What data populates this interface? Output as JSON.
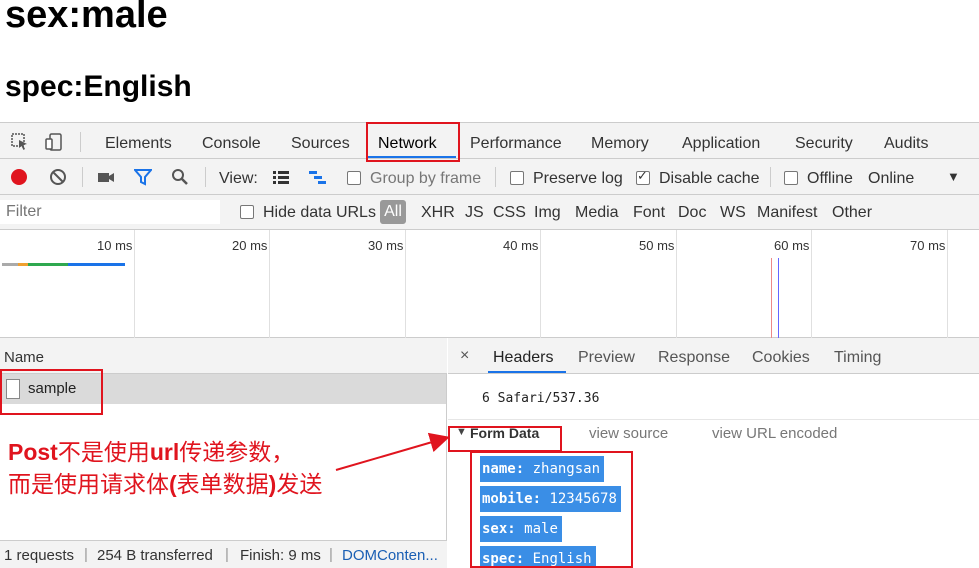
{
  "page": {
    "heading_sex": "sex:male",
    "heading_spec": "spec:English"
  },
  "devtools": {
    "main_tabs": [
      {
        "label": "Elements"
      },
      {
        "label": "Console"
      },
      {
        "label": "Sources"
      },
      {
        "label": "Network",
        "active": true
      },
      {
        "label": "Performance"
      },
      {
        "label": "Memory"
      },
      {
        "label": "Application"
      },
      {
        "label": "Security"
      },
      {
        "label": "Audits"
      }
    ],
    "toolbar": {
      "view_label": "View:",
      "group_by_frame": "Group by frame",
      "preserve_log": "Preserve log",
      "disable_cache": "Disable cache",
      "disable_cache_checked": true,
      "offline": "Offline",
      "throttle": "Online"
    },
    "filter": {
      "placeholder": "Filter",
      "hide_data_urls": "Hide data URLs",
      "types": [
        "All",
        "XHR",
        "JS",
        "CSS",
        "Img",
        "Media",
        "Font",
        "Doc",
        "WS",
        "Manifest",
        "Other"
      ]
    },
    "timeline": {
      "ticks": [
        "10 ms",
        "20 ms",
        "30 ms",
        "40 ms",
        "50 ms",
        "60 ms",
        "70 ms"
      ]
    },
    "requests": {
      "column_name": "Name",
      "rows": [
        {
          "name": "sample"
        }
      ]
    },
    "status": {
      "requests": "1 requests",
      "transferred": "254 B transferred",
      "finish": "Finish: 9 ms",
      "dom": "DOMConten..."
    },
    "detail": {
      "close": "×",
      "tabs": [
        "Headers",
        "Preview",
        "Response",
        "Cookies",
        "Timing"
      ],
      "ua_tail": "6 Safari/537.36",
      "section_title": "Form Data",
      "view_source": "view source",
      "view_url_encoded": "view URL encoded",
      "form_data": [
        {
          "key": "name:",
          "value": "zhangsan"
        },
        {
          "key": "mobile:",
          "value": "12345678"
        },
        {
          "key": "sex:",
          "value": "male"
        },
        {
          "key": "spec:",
          "value": "English"
        }
      ]
    }
  },
  "annotation": {
    "line1_a": "Post",
    "line1_b": "不是使用",
    "line1_c": "url",
    "line1_d": "传递参数，",
    "line2_a": "而是使用请求体",
    "line2_b": "(",
    "line2_c": "表单数据",
    "line2_d": ")",
    "line2_e": "发送",
    "color": "#e0141e"
  },
  "colors": {
    "accent": "#1a73e8",
    "highlight": "#3a8ee6",
    "record": "#e0141e"
  }
}
